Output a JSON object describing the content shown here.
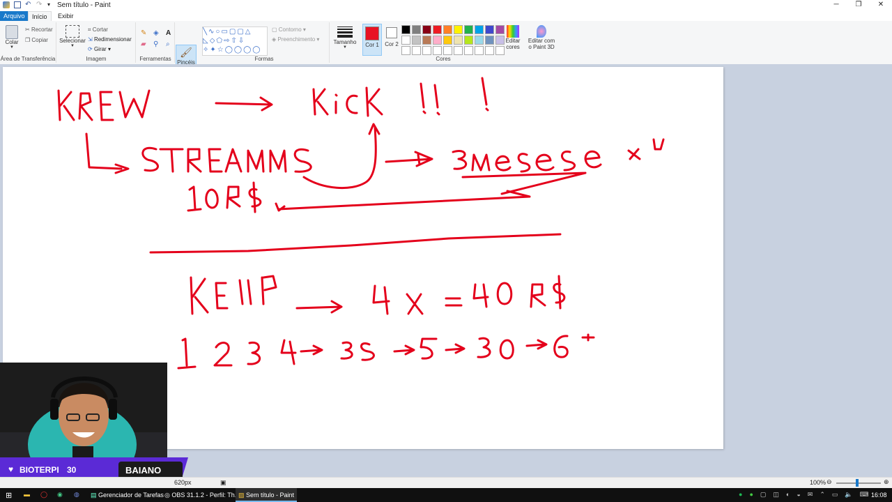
{
  "window": {
    "title": "Sem título - Paint"
  },
  "tabs": [
    "Arquivo",
    "Início",
    "Exibir"
  ],
  "ribbon": {
    "clipboard": {
      "paste": "Colar",
      "cut": "Recortar",
      "copy": "Copiar",
      "label": "Área de Transferência"
    },
    "image": {
      "select": "Selecionar",
      "crop": "Cortar",
      "resize": "Redimensionar",
      "rotate": "Girar",
      "label": "Imagem"
    },
    "tools": {
      "label": "Ferramentas"
    },
    "brushes": {
      "label": "Pincéis"
    },
    "shapes": {
      "outline": "Contorno",
      "fill": "Preenchimento",
      "label": "Formas"
    },
    "size": {
      "label": "Tamanho"
    },
    "colors": {
      "color1": "Cor 1",
      "color2": "Cor 2",
      "edit": "Editar cores",
      "paint3d": "Editar com o Paint 3D",
      "label": "Cores",
      "primary": "#e81224",
      "palette_row1": [
        "#000000",
        "#7f7f7f",
        "#880015",
        "#ed1c24",
        "#ff7f27",
        "#fff200",
        "#22b14c",
        "#00a2e8",
        "#3f48cc",
        "#a349a4"
      ],
      "palette_row2": [
        "#ffffff",
        "#c3c3c3",
        "#b97a57",
        "#ffaec9",
        "#ffc90e",
        "#efe4b0",
        "#b5e61d",
        "#99d9ea",
        "#7092be",
        "#c8bfe7"
      ]
    }
  },
  "status": {
    "size": "620px",
    "zoom": "100%"
  },
  "overlay": {
    "left": "BIOTERPI",
    "count": "30",
    "right": "BAIANO"
  },
  "taskbar": {
    "items": [
      "Gerenciador de Tarefas",
      "OBS 31.1.2 - Perfil: Th...",
      "Sem título - Paint"
    ],
    "time": "16:08"
  },
  "drawing": {
    "ink": "#e4001b"
  }
}
